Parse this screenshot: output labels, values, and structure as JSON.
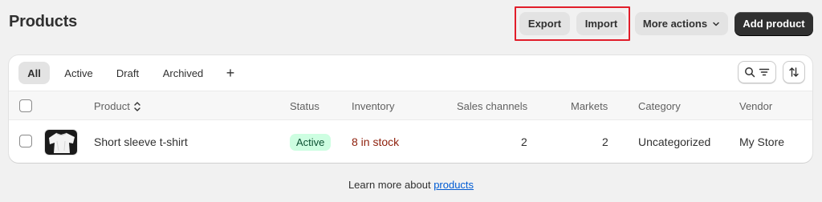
{
  "page": {
    "title": "Products"
  },
  "header_actions": {
    "export_label": "Export",
    "import_label": "Import",
    "more_label": "More actions",
    "add_label": "Add product"
  },
  "tabs": [
    {
      "label": "All"
    },
    {
      "label": "Active"
    },
    {
      "label": "Draft"
    },
    {
      "label": "Archived"
    },
    {
      "label": "+"
    }
  ],
  "table": {
    "columns": [
      "Product",
      "Status",
      "Inventory",
      "Sales channels",
      "Markets",
      "Category",
      "Vendor"
    ],
    "rows": [
      {
        "product": "Short sleeve t-shirt",
        "status": "Active",
        "inventory": "8 in stock",
        "sales_channels": "2",
        "markets": "2",
        "category": "Uncategorized",
        "vendor": "My Store"
      }
    ]
  },
  "footer": {
    "text": "Learn more about",
    "link": "products"
  },
  "colors": {
    "highlight_box": "#e11d2a",
    "status_active_bg": "#cdfee1",
    "inventory_text": "#8e1f0b",
    "link": "#005bd3"
  },
  "icons": [
    "chevron-down-icon",
    "search-icon",
    "filter-icon",
    "sort-icon",
    "sort-arrows-icon"
  ]
}
